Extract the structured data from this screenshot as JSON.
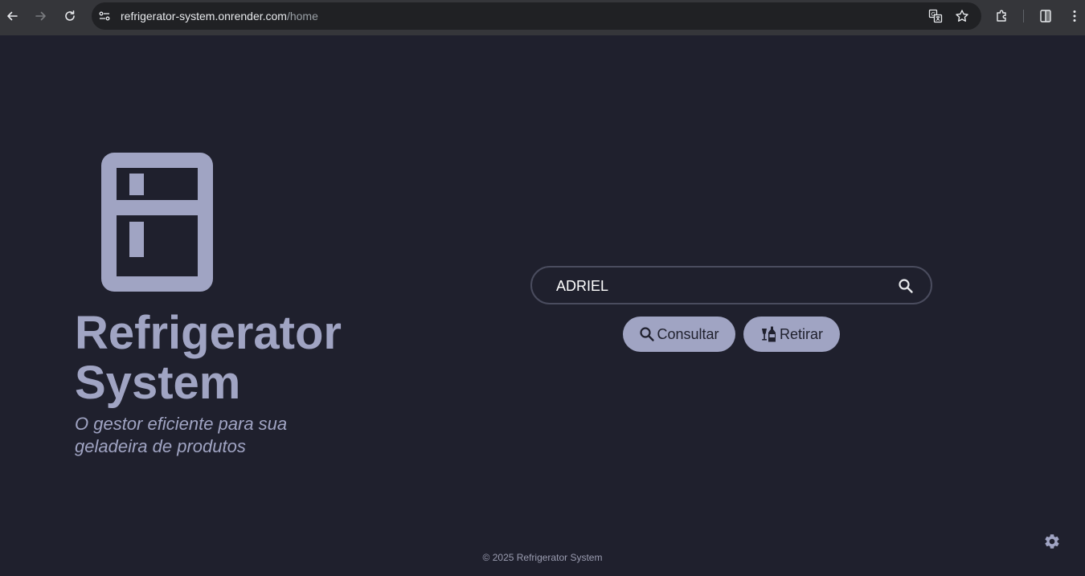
{
  "browser": {
    "url_host": "refrigerator-system.onrender.com",
    "url_path": "/home",
    "icons": [
      "back-icon",
      "forward-icon",
      "reload-icon",
      "site-info-icon",
      "translate-icon",
      "bookmark-star-icon",
      "extensions-icon",
      "side-panel-icon",
      "menu-kebab-icon"
    ]
  },
  "brand": {
    "title": "Refrigerator System",
    "subtitle": "O gestor eficiente para sua geladeira de produtos",
    "logo_icon": "refrigerator-icon"
  },
  "search": {
    "value": "ADRIEL",
    "icon": "search-icon"
  },
  "actions": {
    "consultar_label": "Consultar",
    "consultar_icon": "search-icon",
    "retirar_label": "Retirar",
    "retirar_icon": "bottles-icon"
  },
  "footer": {
    "copyright": "© 2025 Refrigerator System"
  },
  "settings": {
    "icon": "gear-icon"
  },
  "colors": {
    "background": "#1f202d",
    "accent": "#a0a4c3",
    "chrome": "#35363a",
    "omnibox": "#202124"
  }
}
